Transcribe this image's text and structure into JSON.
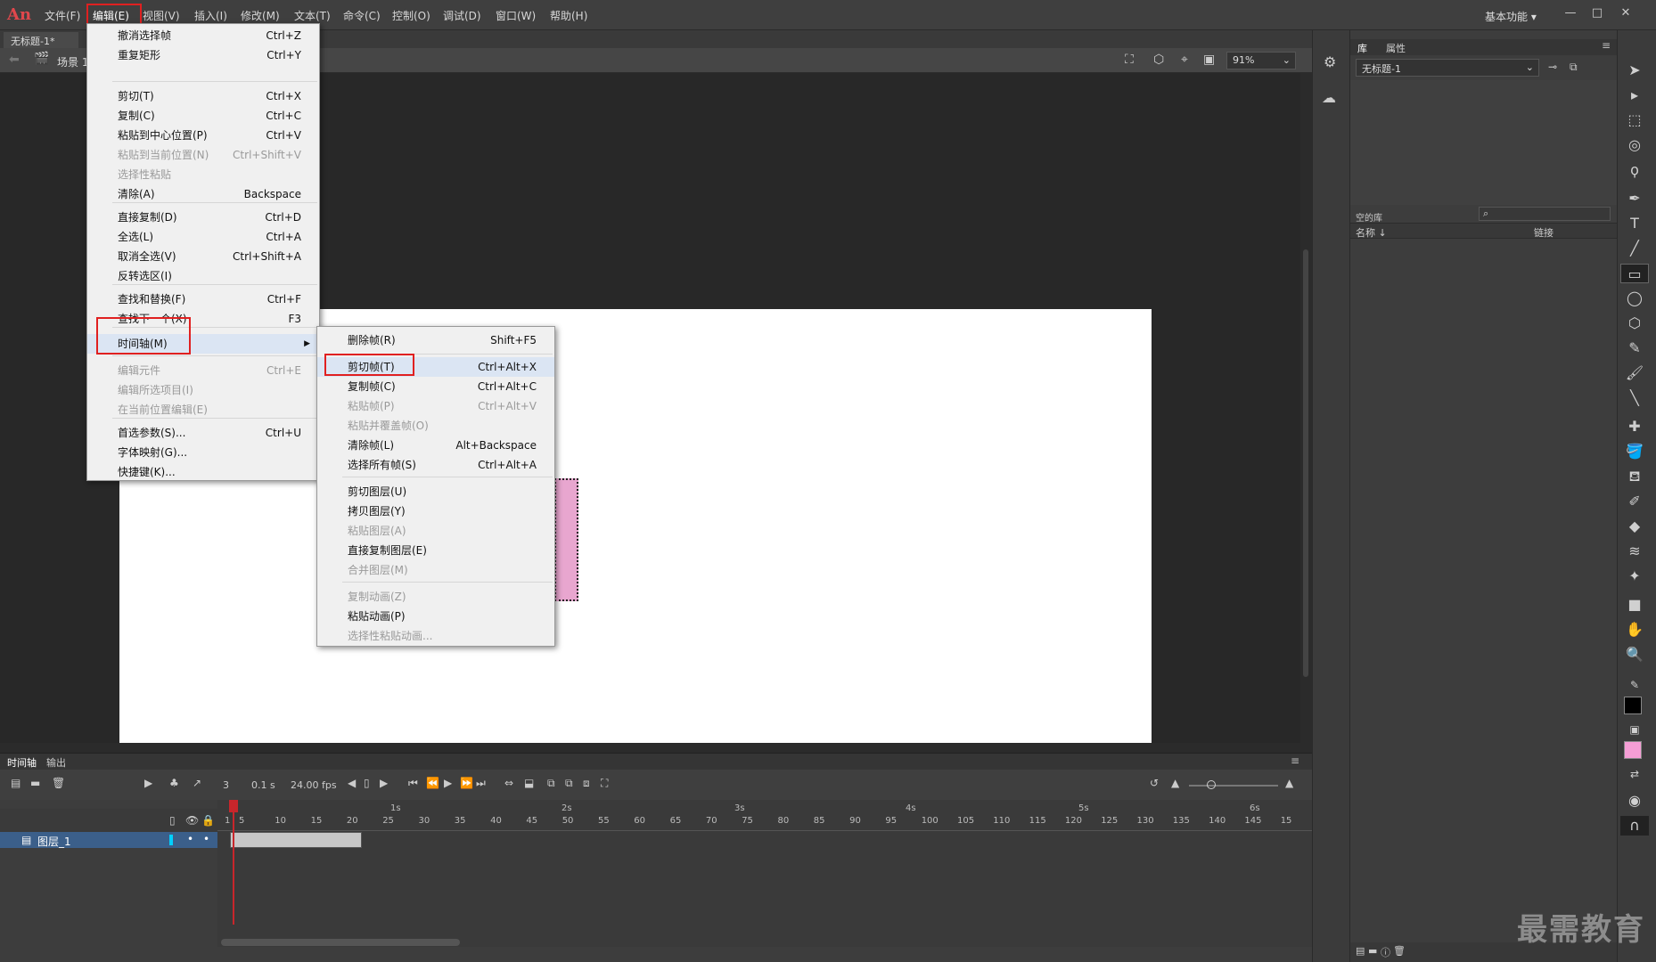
{
  "app": {
    "logo": "An",
    "workspace": "基本功能 ▾"
  },
  "menubar": [
    "文件(F)",
    "编辑(E)",
    "视图(V)",
    "插入(I)",
    "修改(M)",
    "文本(T)",
    "命令(C)",
    "控制(O)",
    "调试(D)",
    "窗口(W)",
    "帮助(H)"
  ],
  "document": {
    "tab": "无标题-1*",
    "close": "×",
    "scene": "场景 1",
    "zoom": "91%"
  },
  "edit_menu": [
    {
      "label": "撤消选择帧",
      "shortcut": "Ctrl+Z",
      "disabled": false
    },
    {
      "label": "重复矩形",
      "shortcut": "Ctrl+Y",
      "disabled": false
    },
    {
      "label": "剪切(T)",
      "shortcut": "Ctrl+X",
      "disabled": false
    },
    {
      "label": "复制(C)",
      "shortcut": "Ctrl+C",
      "disabled": false
    },
    {
      "label": "粘贴到中心位置(P)",
      "shortcut": "Ctrl+V",
      "disabled": false
    },
    {
      "label": "粘贴到当前位置(N)",
      "shortcut": "Ctrl+Shift+V",
      "disabled": true
    },
    {
      "label": "选择性粘贴",
      "shortcut": "",
      "disabled": true
    },
    {
      "label": "清除(A)",
      "shortcut": "Backspace",
      "disabled": false
    },
    {
      "label": "直接复制(D)",
      "shortcut": "Ctrl+D",
      "disabled": false
    },
    {
      "label": "全选(L)",
      "shortcut": "Ctrl+A",
      "disabled": false
    },
    {
      "label": "取消全选(V)",
      "shortcut": "Ctrl+Shift+A",
      "disabled": false
    },
    {
      "label": "反转选区(I)",
      "shortcut": "",
      "disabled": false
    },
    {
      "label": "查找和替换(F)",
      "shortcut": "Ctrl+F",
      "disabled": false
    },
    {
      "label": "查找下一个(X)",
      "shortcut": "F3",
      "disabled": false
    },
    {
      "label": "时间轴(M)",
      "shortcut": "",
      "disabled": false
    },
    {
      "label": "编辑元件",
      "shortcut": "Ctrl+E",
      "disabled": true
    },
    {
      "label": "编辑所选项目(I)",
      "shortcut": "",
      "disabled": true
    },
    {
      "label": "在当前位置编辑(E)",
      "shortcut": "",
      "disabled": true
    },
    {
      "label": "首选参数(S)...",
      "shortcut": "Ctrl+U",
      "disabled": false
    },
    {
      "label": "字体映射(G)...",
      "shortcut": "",
      "disabled": false
    },
    {
      "label": "快捷键(K)...",
      "shortcut": "",
      "disabled": false
    }
  ],
  "timeline_submenu": [
    {
      "label": "删除帧(R)",
      "shortcut": "Shift+F5",
      "disabled": false
    },
    {
      "label": "剪切帧(T)",
      "shortcut": "Ctrl+Alt+X",
      "disabled": false
    },
    {
      "label": "复制帧(C)",
      "shortcut": "Ctrl+Alt+C",
      "disabled": false
    },
    {
      "label": "粘贴帧(P)",
      "shortcut": "Ctrl+Alt+V",
      "disabled": true
    },
    {
      "label": "粘贴并覆盖帧(O)",
      "shortcut": "",
      "disabled": true
    },
    {
      "label": "清除帧(L)",
      "shortcut": "Alt+Backspace",
      "disabled": false
    },
    {
      "label": "选择所有帧(S)",
      "shortcut": "Ctrl+Alt+A",
      "disabled": false
    },
    {
      "label": "剪切图层(U)",
      "shortcut": "",
      "disabled": false
    },
    {
      "label": "拷贝图层(Y)",
      "shortcut": "",
      "disabled": false
    },
    {
      "label": "粘贴图层(A)",
      "shortcut": "",
      "disabled": true
    },
    {
      "label": "直接复制图层(E)",
      "shortcut": "",
      "disabled": false
    },
    {
      "label": "合并图层(M)",
      "shortcut": "",
      "disabled": true
    },
    {
      "label": "复制动画(Z)",
      "shortcut": "",
      "disabled": true
    },
    {
      "label": "粘贴动画(P)",
      "shortcut": "",
      "disabled": false
    },
    {
      "label": "选择性粘贴动画...",
      "shortcut": "",
      "disabled": true
    }
  ],
  "timeline": {
    "tabs": [
      "时间轴",
      "输出"
    ],
    "frame": "3",
    "time": "0.1 s",
    "fps": "24.00 fps",
    "layer": "图层_1",
    "seconds": [
      "1s",
      "2s",
      "3s",
      "4s",
      "5s",
      "6s"
    ],
    "frame_numbers": [
      "1",
      "5",
      "10",
      "15",
      "20",
      "25",
      "30",
      "35",
      "40",
      "45",
      "50",
      "55",
      "60",
      "65",
      "70",
      "75",
      "80",
      "85",
      "90",
      "95",
      "100",
      "105",
      "110",
      "115",
      "120",
      "125",
      "130",
      "135",
      "140",
      "145",
      "15"
    ]
  },
  "library": {
    "tabs": [
      "库",
      "属性"
    ],
    "document": "无标题-1",
    "empty": "空的库",
    "col_name": "名称 ↓",
    "col_link": "链接"
  },
  "watermark": "最需教育",
  "colors": {
    "stroke": "#000000",
    "fill": "#f59ed5",
    "highlight_box": "#e02020"
  }
}
